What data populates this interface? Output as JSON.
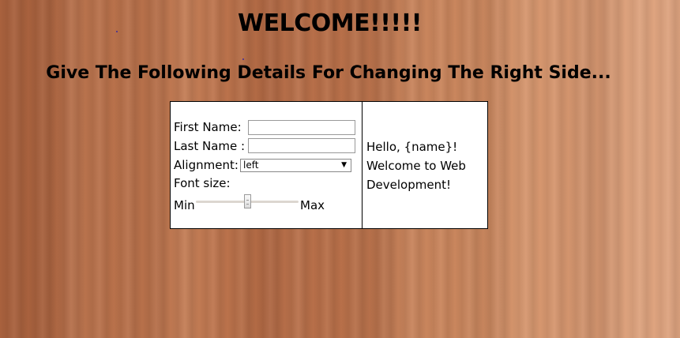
{
  "header": {
    "title": "WELCOME!!!!!",
    "subtitle": "Give The Following Details For Changing The Right Side..."
  },
  "form": {
    "first_name_label": "First Name:",
    "first_name_value": "",
    "last_name_label": "Last Name :",
    "last_name_value": "",
    "alignment_label": "Alignment:",
    "alignment_selected": "left",
    "font_size_label": "Font size:",
    "slider_min_label": "Min",
    "slider_max_label": "Max",
    "slider_value_fraction": 0.5
  },
  "output": {
    "line1": "Hello, {name}!",
    "line2": "Welcome to Web",
    "line3": "Development!"
  },
  "colors": {
    "background": "#b9714a",
    "card": "#ffffff",
    "text": "#000000"
  }
}
